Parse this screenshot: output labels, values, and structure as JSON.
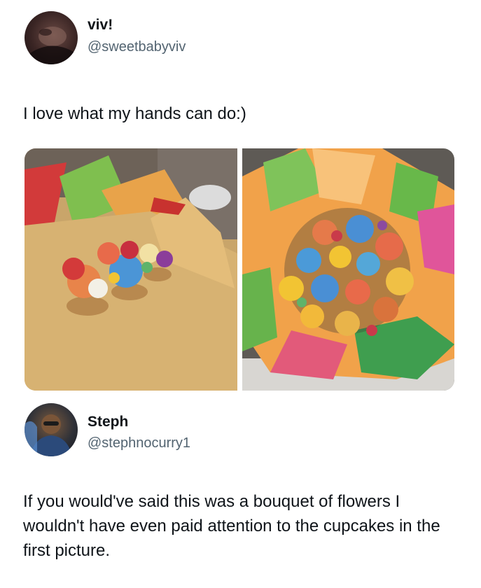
{
  "original_post": {
    "display_name": "viv!",
    "handle": "@sweetbabyviv",
    "text": "I love what my hands can do:)",
    "media": [
      {
        "icon": "photo-cupcakes-on-tissue-paper"
      },
      {
        "icon": "photo-cupcake-bouquet"
      }
    ]
  },
  "reply_post": {
    "display_name": "Steph",
    "handle": "@stephnocurry1",
    "text": "If you would've said this was a bouquet of flowers I wouldn't have even paid attention to the cupcakes in the first picture."
  },
  "colors": {
    "text_primary": "#0f1419",
    "text_secondary": "#536471",
    "background": "#ffffff"
  }
}
